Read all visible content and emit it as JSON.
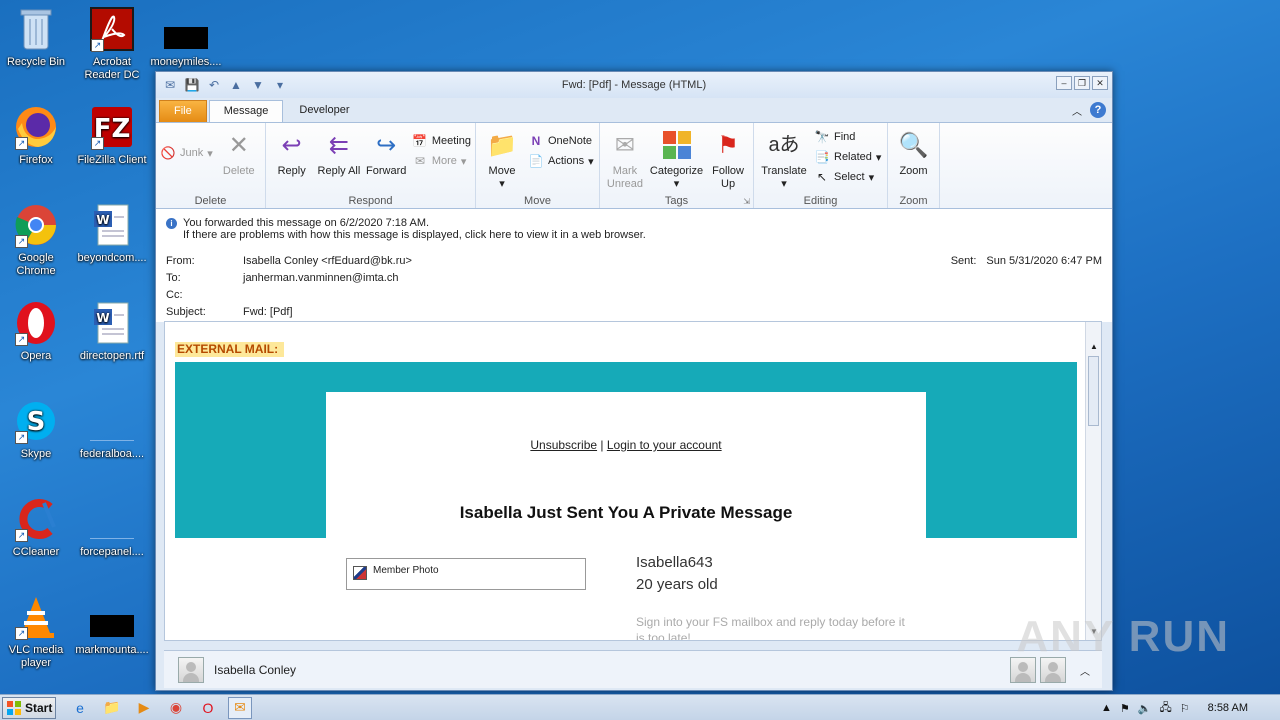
{
  "desktop": {
    "icons": [
      {
        "label": "Recycle Bin",
        "icon": "recycle-bin-icon"
      },
      {
        "label": "Acrobat Reader DC",
        "icon": "acrobat-icon"
      },
      {
        "label": "moneymiles....",
        "icon": "file-icon"
      },
      {
        "label": "Firefox",
        "icon": "firefox-icon"
      },
      {
        "label": "FileZilla Client",
        "icon": "filezilla-icon"
      },
      {
        "label": "Google Chrome",
        "icon": "chrome-icon"
      },
      {
        "label": "beyondcom....",
        "icon": "word-doc-icon"
      },
      {
        "label": "Opera",
        "icon": "opera-icon"
      },
      {
        "label": "directopen.rtf",
        "icon": "word-doc-icon"
      },
      {
        "label": "Skype",
        "icon": "skype-icon"
      },
      {
        "label": "federalboa....",
        "icon": "file-icon"
      },
      {
        "label": "CCleaner",
        "icon": "ccleaner-icon"
      },
      {
        "label": "forcepanel....",
        "icon": "file-icon"
      },
      {
        "label": "VLC media player",
        "icon": "vlc-icon"
      },
      {
        "label": "markmounta....",
        "icon": "file-icon"
      }
    ]
  },
  "window": {
    "title": "Fwd: [Pdf]   - Message (HTML)",
    "tabs": [
      "File",
      "Message",
      "Developer"
    ],
    "active_tab": "Message"
  },
  "ribbon": {
    "delete_group": {
      "name": "Delete",
      "junk": "Junk",
      "delete": "Delete"
    },
    "respond_group": {
      "name": "Respond",
      "reply": "Reply",
      "reply_all": "Reply All",
      "forward": "Forward",
      "meeting": "Meeting",
      "more": "More"
    },
    "move_group": {
      "name": "Move",
      "move": "Move",
      "onenote": "OneNote",
      "actions": "Actions"
    },
    "tags_group": {
      "name": "Tags",
      "mark_unread": "Mark Unread",
      "categorize": "Categorize",
      "follow_up": "Follow Up"
    },
    "editing_group": {
      "name": "Editing",
      "translate": "Translate",
      "find": "Find",
      "related": "Related",
      "select": "Select"
    },
    "zoom_group": {
      "name": "Zoom",
      "zoom": "Zoom"
    }
  },
  "message": {
    "info_line1": "You forwarded this message on 6/2/2020 7:18 AM.",
    "info_line2": "If there are problems with how this message is displayed, click here to view it in a web browser.",
    "from_label": "From:",
    "from": "Isabella Conley <rfEduard@bk.ru>",
    "to_label": "To:",
    "to": "janherman.vanminnen@imta.ch",
    "cc_label": "Cc:",
    "subject_label": "Subject:",
    "subject": "Fwd: [Pdf]",
    "sent_label": "Sent:",
    "sent": "Sun 5/31/2020 6:47 PM"
  },
  "body": {
    "external": "EXTERNAL MAIL:",
    "unsubscribe": "Unsubscribe",
    "separator": "|",
    "login": "Login to your account",
    "headline": "Isabella Just Sent You A Private Message",
    "photo_label": "Member Photo",
    "username": "Isabella643",
    "age": "20 years old",
    "signin_text": "Sign into your FS mailbox and reply today before it is too late!"
  },
  "people_bar": {
    "name": "Isabella Conley"
  },
  "taskbar": {
    "start": "Start",
    "time": "8:58 AM"
  },
  "watermark": "ANY RUN"
}
